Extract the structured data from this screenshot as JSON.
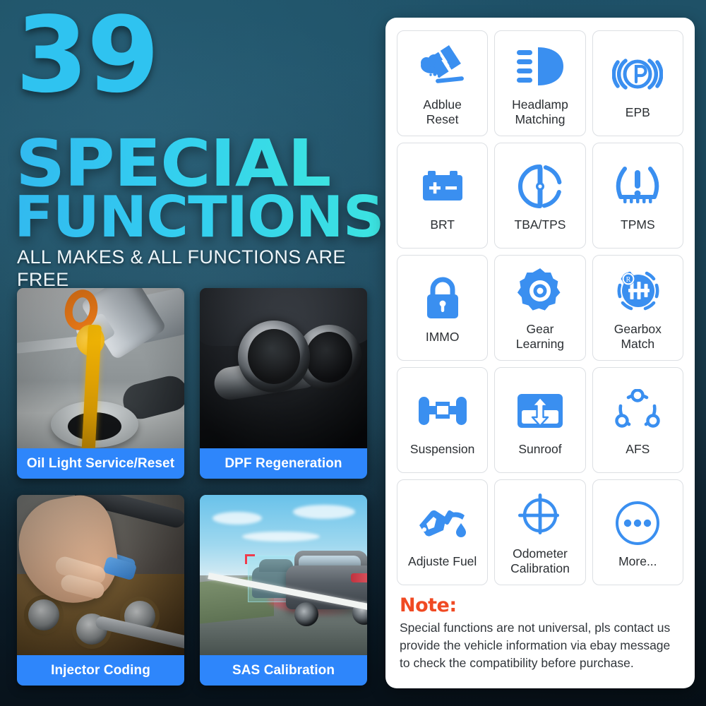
{
  "theme": {
    "accent_cyan": "#2fc3f0",
    "accent_teal": "#3ce4e0",
    "brand_blue": "#2e86fb",
    "icon_blue": "#3a8ff0",
    "note_red": "#f04a23",
    "panel_bg": "#ffffff",
    "background_dark": "#0d1b26"
  },
  "hero": {
    "count": "39",
    "line1": "SPECIAL",
    "line2": "FUNCTIONS",
    "subtitle": "ALL MAKES & ALL FUNCTIONS ARE FREE"
  },
  "photos": [
    {
      "label": "Oil Light Service/Reset",
      "icon": "oil-pour-photo"
    },
    {
      "label": "DPF Regeneration",
      "icon": "exhaust-pipes-photo"
    },
    {
      "label": "Injector Coding",
      "icon": "injector-hand-photo"
    },
    {
      "label": "SAS Calibration",
      "icon": "suv-road-photo"
    }
  ],
  "functions": [
    {
      "label": "Adblue\nReset",
      "label_l1": "Adblue",
      "label_l2": "Reset",
      "icon": "adblue-cloud-filter-icon"
    },
    {
      "label": "Headlamp\nMatching",
      "label_l1": "Headlamp",
      "label_l2": "Matching",
      "icon": "headlamp-beam-icon"
    },
    {
      "label": "EPB",
      "label_l1": "EPB",
      "label_l2": "",
      "icon": "electronic-parking-brake-icon"
    },
    {
      "label": "BRT",
      "label_l1": "BRT",
      "label_l2": "",
      "icon": "battery-icon"
    },
    {
      "label": "TBA/TPS",
      "label_l1": "TBA/TPS",
      "label_l2": "",
      "icon": "throttle-body-icon"
    },
    {
      "label": "TPMS",
      "label_l1": "TPMS",
      "label_l2": "",
      "icon": "tire-pressure-warning-icon"
    },
    {
      "label": "IMMO",
      "label_l1": "IMMO",
      "label_l2": "",
      "icon": "padlock-icon"
    },
    {
      "label": "Gear\nLearning",
      "label_l1": "Gear",
      "label_l2": "Learning",
      "icon": "gear-cog-icon"
    },
    {
      "label": "Gearbox\nMatch",
      "label_l1": "Gearbox",
      "label_l2": "Match",
      "icon": "gearbox-shift-pattern-icon"
    },
    {
      "label": "Suspension",
      "label_l1": "Suspension",
      "label_l2": "",
      "icon": "axle-wheels-icon"
    },
    {
      "label": "Sunroof",
      "label_l1": "Sunroof",
      "label_l2": "",
      "icon": "sunroof-arrows-icon"
    },
    {
      "label": "AFS",
      "label_l1": "AFS",
      "label_l2": "",
      "icon": "three-nodes-circle-icon"
    },
    {
      "label": "Adjuste Fuel",
      "label_l1": "Adjuste Fuel",
      "label_l2": "",
      "icon": "fuel-nozzle-drop-icon"
    },
    {
      "label": "Odometer\nCalibration",
      "label_l1": "Odometer",
      "label_l2": "Calibration",
      "icon": "crosshair-target-icon"
    },
    {
      "label": "More...",
      "label_l1": "More...",
      "label_l2": "",
      "icon": "ellipsis-circle-icon"
    }
  ],
  "note": {
    "title": "Note:",
    "body": "Special functions are not universal, pls contact us provide the vehicle information via ebay message to check the compatibility before purchase."
  }
}
